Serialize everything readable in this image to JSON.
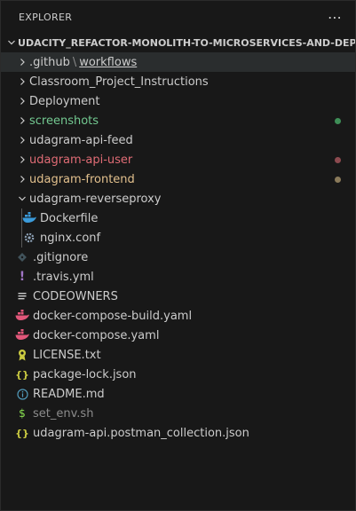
{
  "explorer": {
    "title": "EXPLORER",
    "more_icon": "ellipsis-icon",
    "project_name": "UDACITY_REFACTOR-MONOLITH-TO-MICROSERVICES-AND-DEPLOY"
  },
  "tree": {
    "github_folder": ".github",
    "github_sep": "\\",
    "github_sub": "workflows",
    "classroom": "Classroom_Project_Instructions",
    "deployment": "Deployment",
    "screenshots": "screenshots",
    "api_feed": "udagram-api-feed",
    "api_user": "udagram-api-user",
    "frontend": "udagram-frontend",
    "reverseproxy": "udagram-reverseproxy",
    "dockerfile": "Dockerfile",
    "nginx": "nginx.conf",
    "gitignore": ".gitignore",
    "travis": ".travis.yml",
    "codeowners": "CODEOWNERS",
    "compose_build": "docker-compose-build.yaml",
    "compose": "docker-compose.yaml",
    "license": "LICENSE.txt",
    "package_lock": "package-lock.json",
    "readme": "README.md",
    "set_env": "set_env.sh",
    "postman": "udagram-api.postman_collection.json"
  },
  "colors": {
    "untracked": "#73c991",
    "modified_red": "#e06c75",
    "modified_gold": "#e2c08d",
    "ignored": "#8c8c8c",
    "docker_blue": "#3b9bdb",
    "docker_pink": "#e2577a",
    "json_yellow": "#cbcb41",
    "info_blue": "#519aba",
    "shell_green": "#89e051",
    "travis_purple": "#a074c4"
  }
}
